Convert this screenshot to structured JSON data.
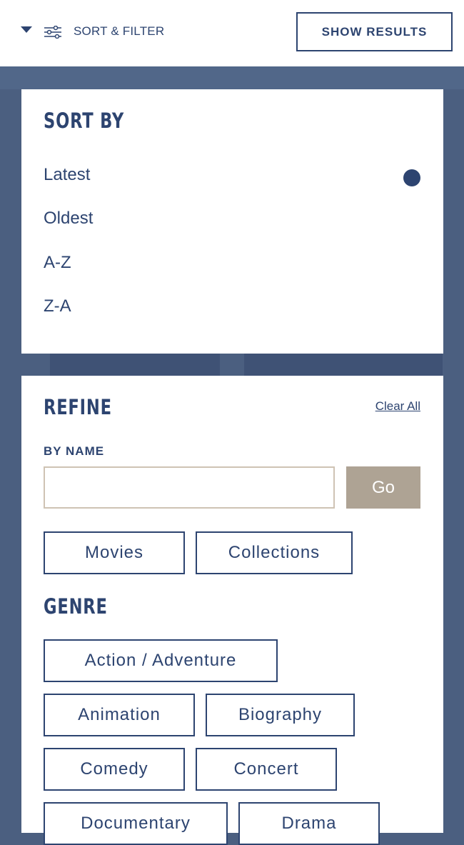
{
  "header": {
    "sort_filter_label": "SORT & FILTER",
    "show_results_label": "SHOW RESULTS"
  },
  "sort_by": {
    "title": "SORT BY",
    "options": [
      "Latest",
      "Oldest",
      "A-Z",
      "Z-A"
    ],
    "selected": "Latest"
  },
  "refine": {
    "title": "REFINE",
    "clear_all": "Clear All",
    "by_name_label": "BY NAME",
    "name_value": "",
    "go_label": "Go",
    "types": [
      "Movies",
      "Collections"
    ]
  },
  "genre": {
    "title": "GENRE",
    "items": [
      "Action / Adventure",
      "Animation",
      "Biography",
      "Comedy",
      "Concert",
      "Documentary",
      "Drama"
    ]
  },
  "colors": {
    "primary": "#2d4470",
    "background": "#4b5f80",
    "go_button": "#aea394",
    "input_border": "#cfc3b4"
  }
}
